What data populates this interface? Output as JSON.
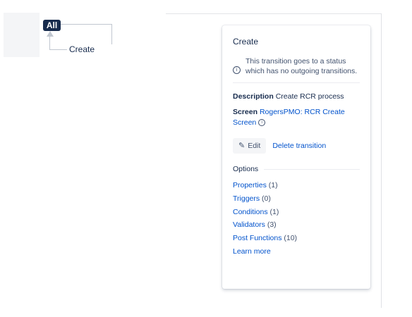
{
  "diagram": {
    "all_label": "All",
    "node_label": "Create"
  },
  "panel": {
    "title": "Create",
    "info_text": "This transition goes to a status which has no outgoing transitions.",
    "description_label": "Description",
    "description_value": "Create RCR process",
    "screen_label": "Screen",
    "screen_value": "RogersPMO: RCR Create Screen",
    "edit_label": "Edit",
    "delete_label": "Delete transition",
    "options_title": "Options",
    "options": [
      {
        "label": "Properties",
        "count": "(1)"
      },
      {
        "label": "Triggers",
        "count": "(0)"
      },
      {
        "label": "Conditions",
        "count": "(1)"
      },
      {
        "label": "Validators",
        "count": "(3)"
      },
      {
        "label": "Post Functions",
        "count": "(10)"
      }
    ],
    "learn_more": "Learn more"
  }
}
